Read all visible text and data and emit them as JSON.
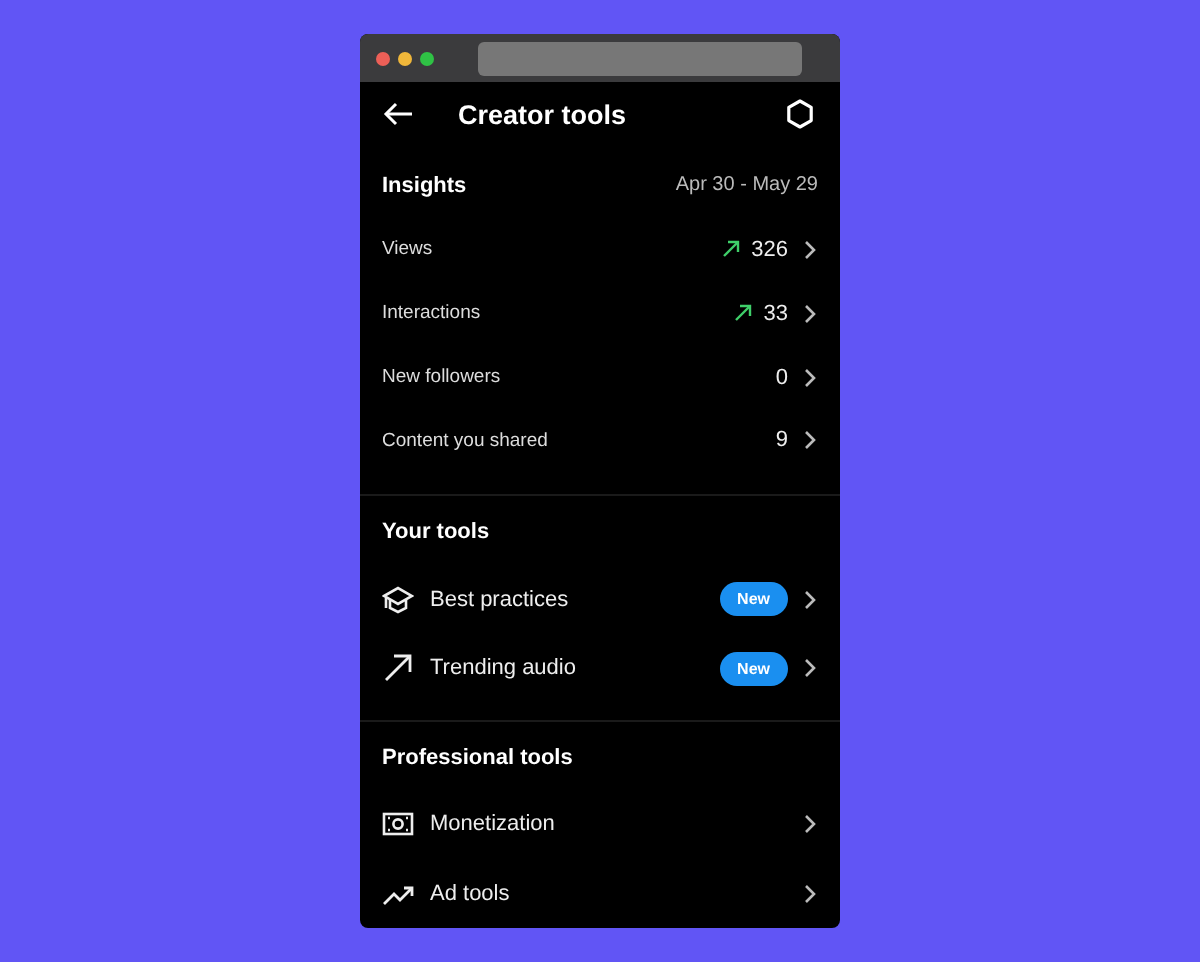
{
  "header": {
    "title": "Creator tools"
  },
  "insights": {
    "title": "Insights",
    "date_range": "Apr 30 - May 29",
    "rows": [
      {
        "label": "Views",
        "value": "326",
        "trending": true
      },
      {
        "label": "Interactions",
        "value": "33",
        "trending": true
      },
      {
        "label": "New followers",
        "value": "0",
        "trending": false
      },
      {
        "label": "Content you shared",
        "value": "9",
        "trending": false
      }
    ]
  },
  "your_tools": {
    "title": "Your tools",
    "items": [
      {
        "kind": "cap",
        "label": "Best practices",
        "badge": "New"
      },
      {
        "kind": "arrow",
        "label": "Trending audio",
        "badge": "New"
      }
    ]
  },
  "professional_tools": {
    "title": "Professional tools",
    "items": [
      {
        "kind": "money",
        "label": "Monetization"
      },
      {
        "kind": "chart",
        "label": "Ad tools"
      }
    ]
  }
}
